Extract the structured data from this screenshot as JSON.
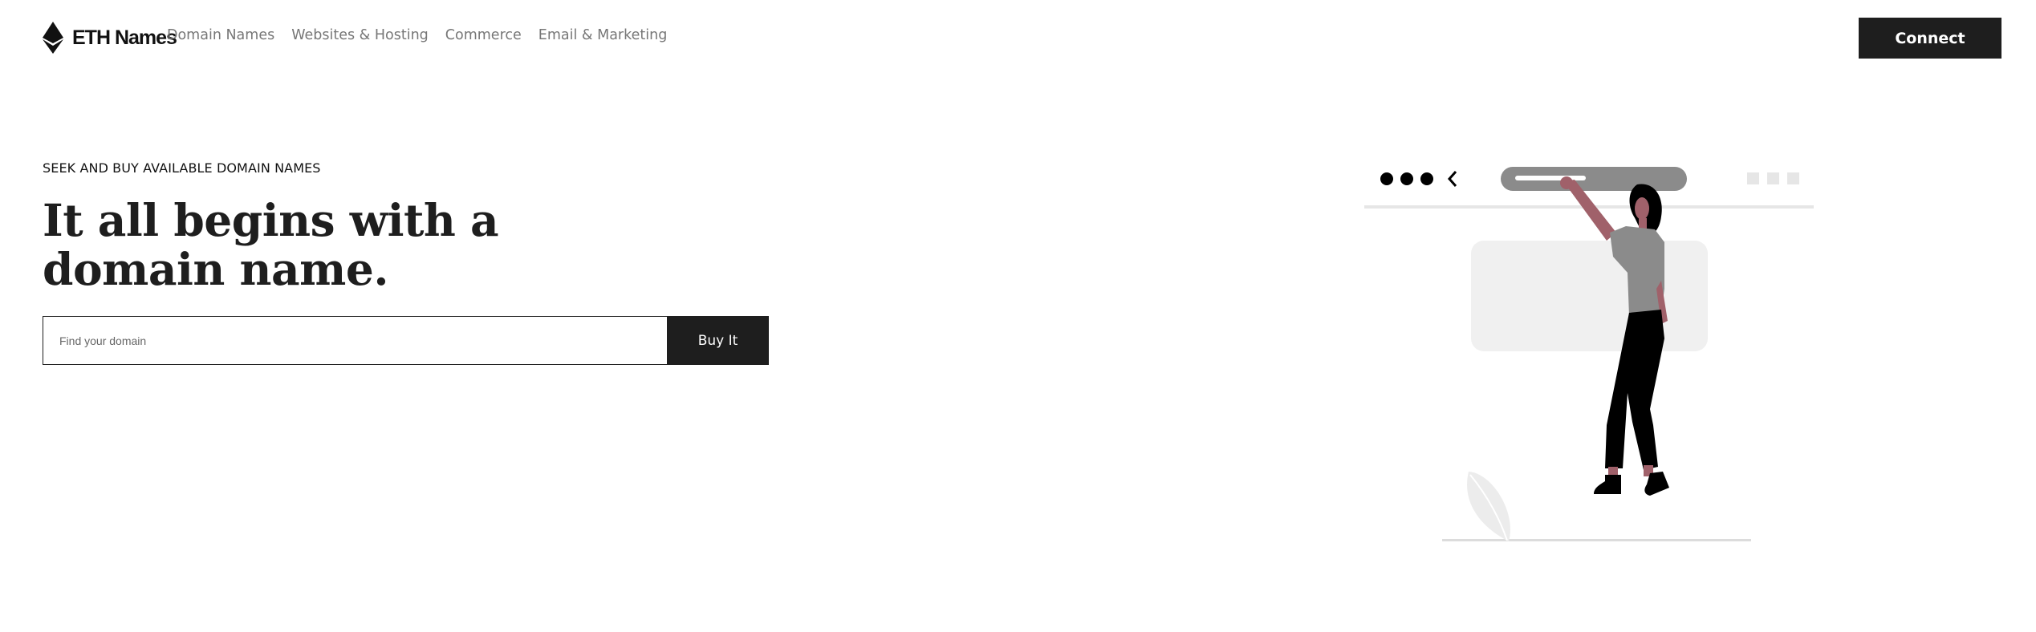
{
  "brand": {
    "name": "ETH Names",
    "logo_icon": "ethereum-diamond-icon"
  },
  "nav": {
    "items": [
      {
        "label": "Domain Names"
      },
      {
        "label": "Websites & Hosting"
      },
      {
        "label": "Commerce"
      },
      {
        "label": "Email & Marketing"
      }
    ]
  },
  "header": {
    "connect_label": "Connect"
  },
  "hero": {
    "eyebrow": "SEEK AND BUY AVAILABLE DOMAIN NAMES",
    "headline_line1": "It all begins with a",
    "headline_line2": "domain name.",
    "search_placeholder": "Find your domain",
    "search_value": "",
    "buy_label": "Buy It"
  },
  "illustration": {
    "icons": [
      "browser-dots-icon",
      "back-chevron-icon",
      "address-bar",
      "window-controls-icon",
      "plant-icon",
      "woman-figure"
    ],
    "colors": {
      "accent": "#a0616a",
      "dark": "#000000",
      "gray": "#8b8b8b",
      "light": "#e6e6e6"
    }
  },
  "colors": {
    "primary": "#1e1e1e",
    "nav_text": "#777777",
    "background": "#ffffff"
  }
}
